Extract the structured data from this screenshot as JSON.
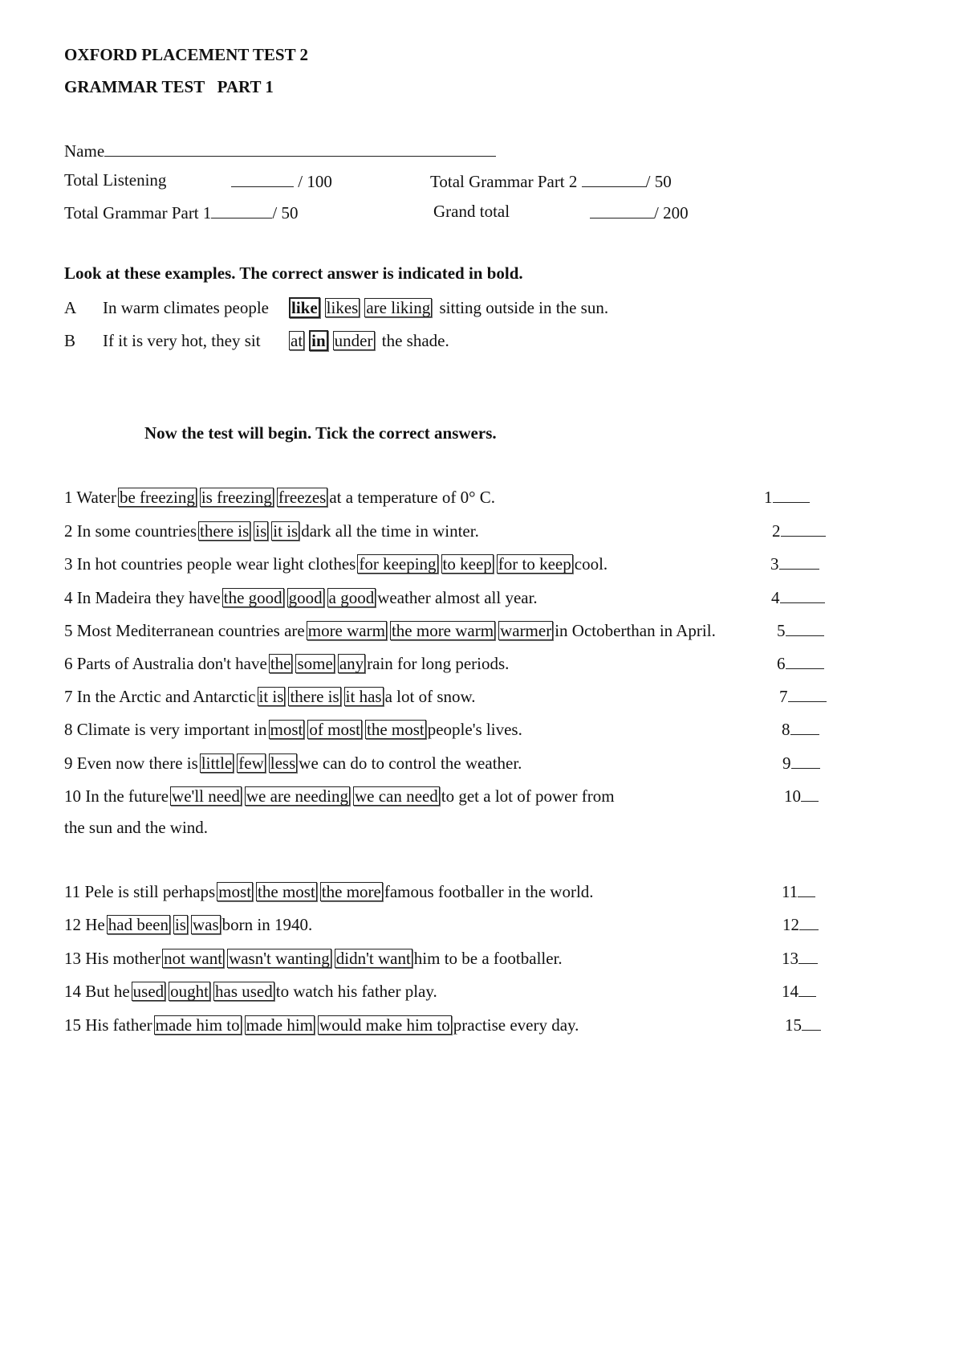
{
  "header": {
    "title": "OXFORD PLACEMENT TEST 2",
    "subtitle": "GRAMMAR TEST   PART 1"
  },
  "scores": {
    "name_label": "Name",
    "listening_label": "Total Listening",
    "listening_max": "/ 100",
    "grammar1_label": "Total Grammar Part 1",
    "grammar1_max": "/ 50",
    "grammar2_label": "Total Grammar Part 2",
    "grammar2_max": "/ 50",
    "grand_label": "Grand total",
    "grand_max": "/ 200"
  },
  "examples": {
    "instruction": "Look at these examples. The correct answer is indicated in bold.",
    "items": [
      {
        "letter": "A",
        "before": "In warm climates people",
        "options": [
          "like",
          "likes",
          "are liking"
        ],
        "correct": 0,
        "after": "sitting outside in the sun."
      },
      {
        "letter": "B",
        "before": "If it is very hot, they sit",
        "options": [
          "at",
          "in",
          "under"
        ],
        "correct": 1,
        "after": "the shade."
      }
    ]
  },
  "test": {
    "instruction": "Now the test will begin. Tick the correct answers.",
    "questions": [
      {
        "num": "1",
        "before": "1 Water",
        "options": [
          "be freezing",
          "is freezing",
          "freezes"
        ],
        "after": "at a temperature of 0° C.",
        "answer_label": "1"
      },
      {
        "num": "2",
        "before": "2 In some  countries",
        "options": [
          "there is",
          "is",
          "it is"
        ],
        "after": "dark all the time in winter.",
        "answer_label": "2"
      },
      {
        "num": "3",
        "before": "3 In hot countries people wear light clothes",
        "options": [
          "for keeping",
          "to keep",
          "for to keep"
        ],
        "after": "cool.",
        "answer_label": "3"
      },
      {
        "num": "4",
        "before": "4 In Madeira they have",
        "options": [
          "the good",
          "good",
          "a good"
        ],
        "after": "weather almost all year.",
        "answer_label": "4"
      },
      {
        "num": "5",
        "before": "5 Most Mediterranean countries are",
        "options": [
          "more warm",
          "the more warm",
          "warmer"
        ],
        "after": "in Octoberthan in April.",
        "answer_label": "5"
      },
      {
        "num": "6",
        "before": "6 Parts of Australia don't have",
        "options": [
          "the",
          "some",
          "any"
        ],
        "after": "rain for long periods.",
        "answer_label": "6"
      },
      {
        "num": "7",
        "before": "7 In the Arctic and Antarctic",
        "options": [
          "it is",
          "there is",
          "it has"
        ],
        "after": "a lot of snow.",
        "answer_label": "7"
      },
      {
        "num": "8",
        "before": "8 Climate is very important in",
        "options": [
          "most",
          "of most",
          "the most"
        ],
        "after": "people's lives.",
        "answer_label": "8"
      },
      {
        "num": "9",
        "before": "9 Even now there is",
        "options": [
          "little",
          "few",
          "less"
        ],
        "after": "we can do to control the weather.",
        "answer_label": "9"
      },
      {
        "num": "10",
        "before": "10 In the future",
        "options": [
          "we'll need",
          "we are needing",
          "we can need"
        ],
        "after": "to get a lot of power from",
        "continuation": "the sun and the wind.",
        "answer_label": "10"
      },
      {
        "num": "11",
        "before": "11 Pele is still perhaps",
        "options": [
          "most",
          "the most",
          "the more"
        ],
        "after": "famous footballer in the world.",
        "answer_label": "11"
      },
      {
        "num": "12",
        "before": "12 He",
        "options": [
          "had been",
          "is",
          "was"
        ],
        "after": "born in 1940.",
        "answer_label": "12"
      },
      {
        "num": "13",
        "before": "13 His mother",
        "options": [
          "not want",
          "wasn't wanting",
          "didn't want"
        ],
        "after": "him to be a footballer.",
        "answer_label": "13"
      },
      {
        "num": "14",
        "before": "14 But he",
        "options": [
          "used",
          "ought",
          "has used"
        ],
        "after": "to watch  his father play.",
        "answer_label": "14"
      },
      {
        "num": "15",
        "before": "15 His father",
        "options": [
          "made him to",
          "made him",
          "would make him to"
        ],
        "after": "practise every day.",
        "answer_label": "15"
      }
    ]
  }
}
